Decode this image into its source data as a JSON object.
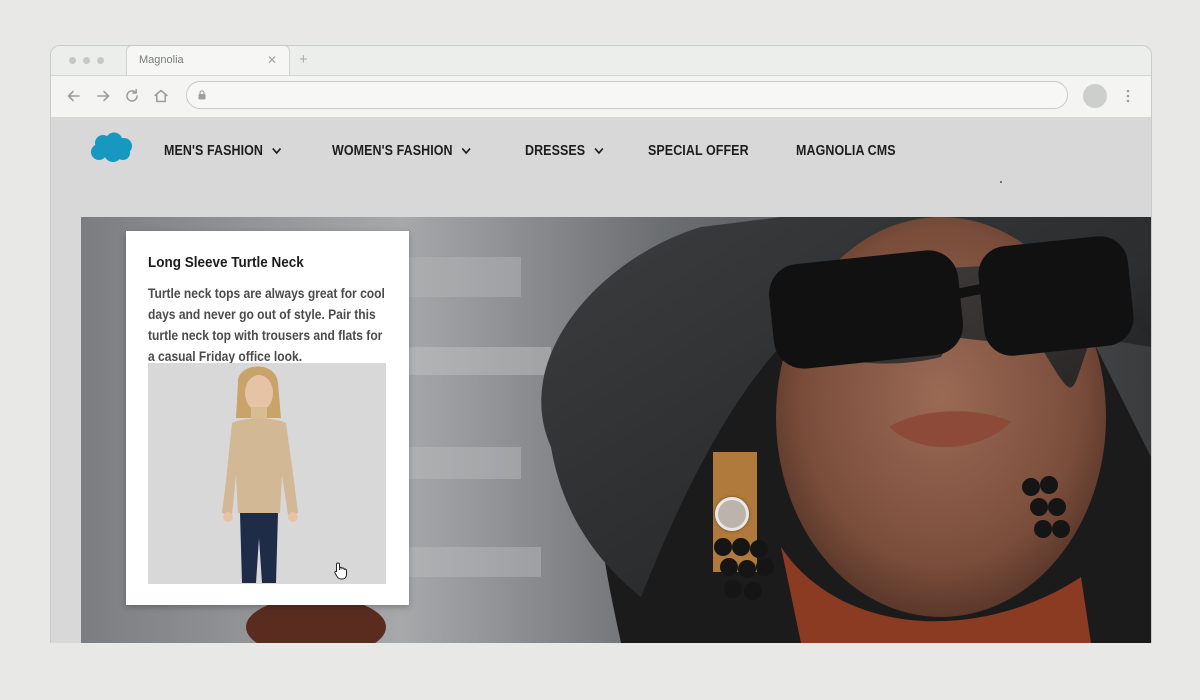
{
  "browser": {
    "tab_title": "Magnolia",
    "tab_close_icon": "close-icon",
    "new_tab_icon": "plus-icon",
    "address": "",
    "toolbar_icons": [
      "arrow-left-icon",
      "arrow-right-icon",
      "reload-icon",
      "home-icon",
      "lock-icon",
      "profile-avatar",
      "more-vertical-icon"
    ]
  },
  "site": {
    "logo": "salesforce-cloud-logo",
    "logo_color": "#1798c1",
    "nav": [
      {
        "label": "MEN'S FASHION",
        "has_dropdown": true
      },
      {
        "label": "WOMEN'S FASHION",
        "has_dropdown": true
      },
      {
        "label": "DRESSES",
        "has_dropdown": true
      },
      {
        "label": "SPECIAL OFFER",
        "has_dropdown": false
      },
      {
        "label": "MAGNOLIA CMS",
        "has_dropdown": false
      }
    ]
  },
  "hero": {
    "image": "woman-in-black-hat-and-sunglasses",
    "hotspot": "product-hotspot",
    "card": {
      "title": "Long Sleeve Turtle Neck",
      "description": "Turtle neck tops are always great for cool days and never go out of style. Pair this turtle neck top with trousers and flats for a casual Friday office look.",
      "image": "woman-in-beige-turtleneck-and-jeans"
    }
  },
  "colors": {
    "page_bg": "#e8e9e7",
    "header_bg": "#d8d8d8",
    "nav_text": "#1d1d1d",
    "card_bg": "#ffffff"
  }
}
